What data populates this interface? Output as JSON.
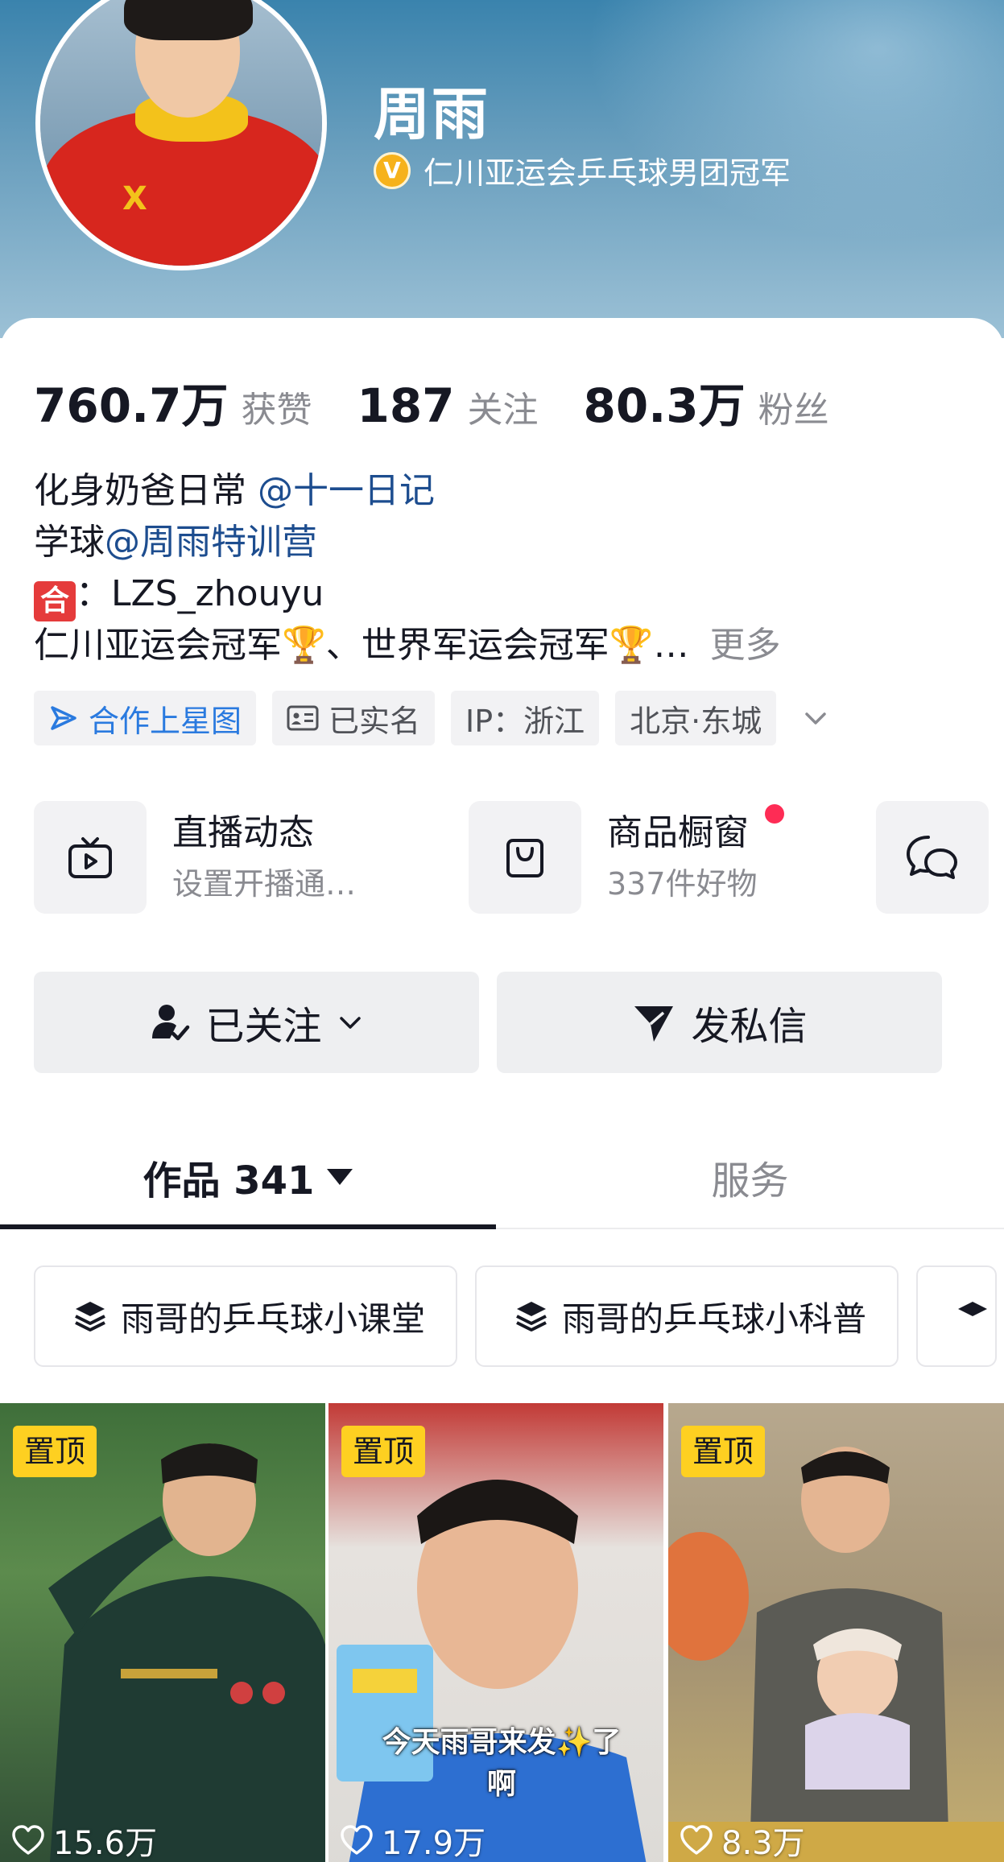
{
  "profile": {
    "name": "周雨",
    "verify_text": "仁川亚运会乒乓球男团冠军",
    "verify_icon": "v-badge-icon"
  },
  "stats": [
    {
      "value": "760.7万",
      "label": "获赞"
    },
    {
      "value": "187",
      "label": "关注"
    },
    {
      "value": "80.3万",
      "label": "粉丝"
    }
  ],
  "bio": {
    "line1_text": "化身奶爸日常 ",
    "line1_mention": "@十一日记",
    "line2_text": "学球",
    "line2_mention": "@周雨特训营",
    "line3_badge": "合",
    "line3_text": "：LZS_zhouyu",
    "line4_text": "仁川亚运会冠军🏆、世界军运会冠军🏆…",
    "more": "更多"
  },
  "tags": [
    {
      "label": "合作上星图",
      "icon": "star-map-icon"
    },
    {
      "label": "已实名",
      "icon": "id-card-icon"
    },
    {
      "label": "IP：浙江"
    },
    {
      "label": "北京·东城"
    }
  ],
  "services": {
    "live": {
      "title": "直播动态",
      "subtitle": "设置开播通…",
      "icon": "tv-icon"
    },
    "shop": {
      "title": "商品橱窗",
      "subtitle": "337件好物",
      "icon": "bag-icon"
    },
    "chat": {
      "icon": "chat-bubbles-icon"
    }
  },
  "actions": {
    "follow_label": "已关注",
    "message_label": "发私信"
  },
  "tabs": {
    "works_label": "作品 341",
    "service_label": "服务"
  },
  "collections": [
    {
      "label": "雨哥的乒乓球小课堂"
    },
    {
      "label": "雨哥的乒乓球小科普"
    }
  ],
  "videos": [
    {
      "pin": "置顶",
      "likes": "15.6万"
    },
    {
      "pin": "置顶",
      "likes": "17.9万",
      "caption": "今天雨哥来发✨了啊"
    },
    {
      "pin": "置顶",
      "likes": "8.3万"
    }
  ],
  "colors": {
    "accent_blue": "#2a7adf",
    "mention_blue": "#1d4d8f",
    "pin_yellow": "#fed021",
    "notice_red": "#fe2c55"
  }
}
